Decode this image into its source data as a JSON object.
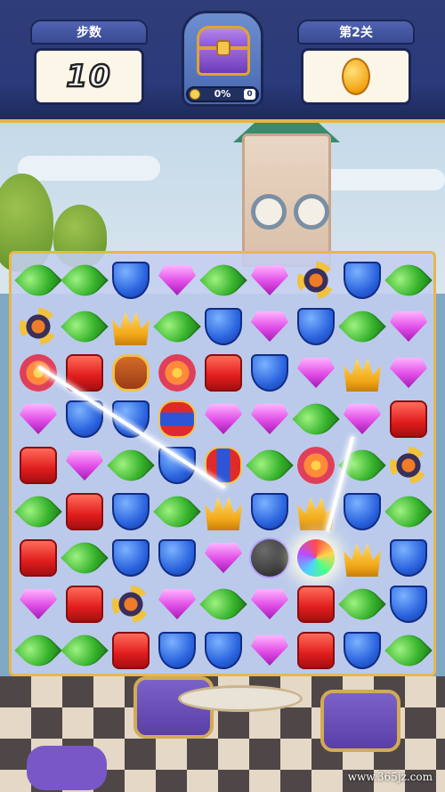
{
  "hud": {
    "moves_title": "步数",
    "moves_value": "10",
    "level_title": "第2关",
    "goal_icon": "coin-icon",
    "chest_icon": "treasure-chest-icon",
    "chest_progress_text": "0%",
    "chest_progress_fraction": 0,
    "chest_count": "0"
  },
  "board": {
    "rows": 9,
    "cols": 9,
    "tiles": [
      [
        "leaf",
        "leaf",
        "shield",
        "gem",
        "leaf",
        "gem",
        "propeller",
        "shield",
        "leaf"
      ],
      [
        "propeller",
        "leaf",
        "crown",
        "leaf",
        "shield",
        "gem",
        "shield",
        "leaf",
        "gem"
      ],
      [
        "disc",
        "box",
        "tnt",
        "disc",
        "box",
        "shield",
        "gem",
        "crown",
        "gem"
      ],
      [
        "gem",
        "shield",
        "shield",
        "rocketv",
        "gem",
        "gem",
        "leaf",
        "gem",
        "box"
      ],
      [
        "box",
        "gem",
        "leaf",
        "shield",
        "rocket",
        "leaf",
        "disc",
        "leaf",
        "propeller"
      ],
      [
        "leaf",
        "box",
        "shield",
        "leaf",
        "crown",
        "shield",
        "crown",
        "shield",
        "leaf"
      ],
      [
        "box",
        "leaf",
        "shield",
        "shield",
        "gem",
        "bomb",
        "colorball",
        "crown",
        "shield"
      ],
      [
        "gem",
        "box",
        "propeller",
        "gem",
        "leaf",
        "gem",
        "box",
        "leaf",
        "shield"
      ],
      [
        "leaf",
        "leaf",
        "box",
        "shield",
        "shield",
        "gem",
        "box",
        "shield",
        "leaf"
      ]
    ]
  },
  "watermark": "www.365jz.com"
}
